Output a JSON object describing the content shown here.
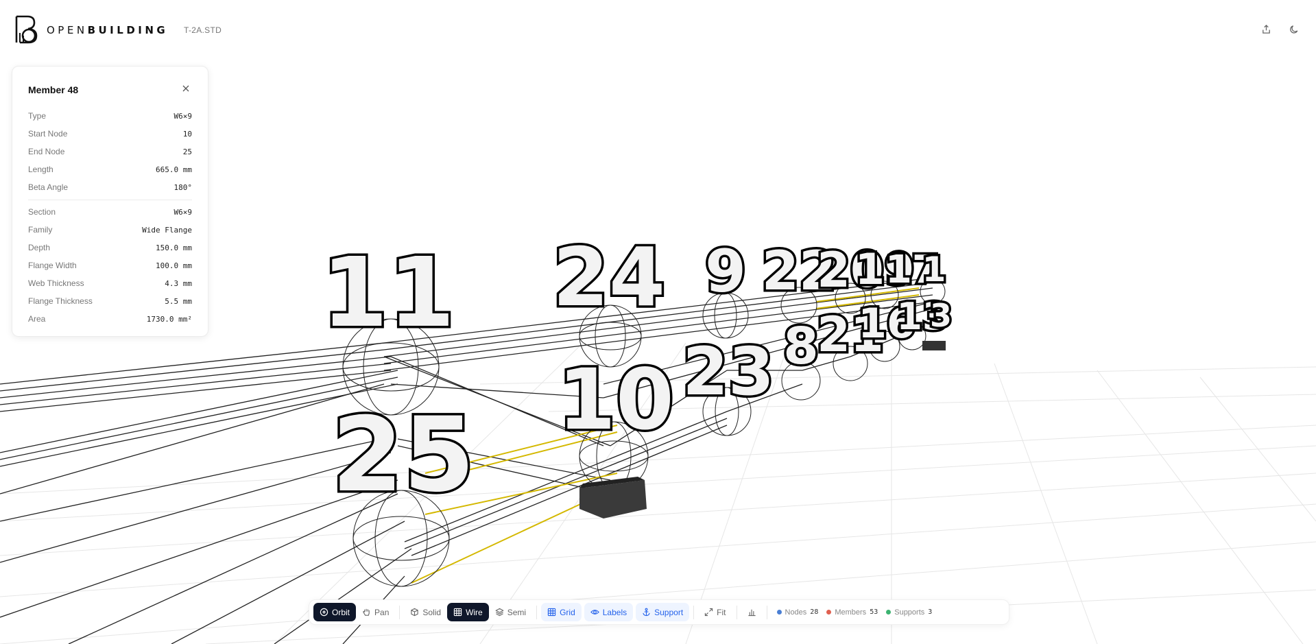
{
  "app": {
    "brand_light": "OPEN",
    "brand_bold": "BUILDING",
    "filename": "T-2A.STD"
  },
  "icons": {
    "logo": "openbuilding-logo",
    "export": "share-upload-icon",
    "theme": "moon-icon",
    "close": "close-icon"
  },
  "panel": {
    "title": "Member 48",
    "rows": [
      {
        "label": "Type",
        "value": "W6×9"
      },
      {
        "label": "Start Node",
        "value": "10"
      },
      {
        "label": "End Node",
        "value": "25"
      },
      {
        "label": "Length",
        "value": "665.0 mm"
      },
      {
        "label": "Beta Angle",
        "value": "180°"
      }
    ],
    "section_rows": [
      {
        "label": "Section",
        "value": "W6×9"
      },
      {
        "label": "Family",
        "value": "Wide Flange"
      },
      {
        "label": "Depth",
        "value": "150.0 mm"
      },
      {
        "label": "Flange Width",
        "value": "100.0 mm"
      },
      {
        "label": "Web Thickness",
        "value": "4.3 mm"
      },
      {
        "label": "Flange Thickness",
        "value": "5.5 mm"
      },
      {
        "label": "Area",
        "value": "1730.0 mm²"
      }
    ]
  },
  "toolbar": {
    "orbit": "Orbit",
    "pan": "Pan",
    "solid": "Solid",
    "wire": "Wire",
    "semi": "Semi",
    "grid": "Grid",
    "labels": "Labels",
    "support": "Support",
    "fit": "Fit",
    "active_mode": "Orbit",
    "active_render": "Wire"
  },
  "stats": {
    "nodes_label": "Nodes",
    "nodes": "28",
    "members_label": "Members",
    "members": "53",
    "supports_label": "Supports",
    "supports": "3"
  },
  "colors": {
    "dark": "#0f172a",
    "accent_blue": "#2563eb",
    "node_dot": "#4a7fd4",
    "member_dot": "#e06050",
    "support_dot": "#3cb371",
    "highlight_member": "#d4b800"
  },
  "scene": {
    "node_labels": [
      "11",
      "24",
      "9",
      "22",
      "20",
      "19",
      "17",
      "1",
      "25",
      "10",
      "23",
      "8",
      "21",
      "16",
      "13",
      "3"
    ]
  }
}
